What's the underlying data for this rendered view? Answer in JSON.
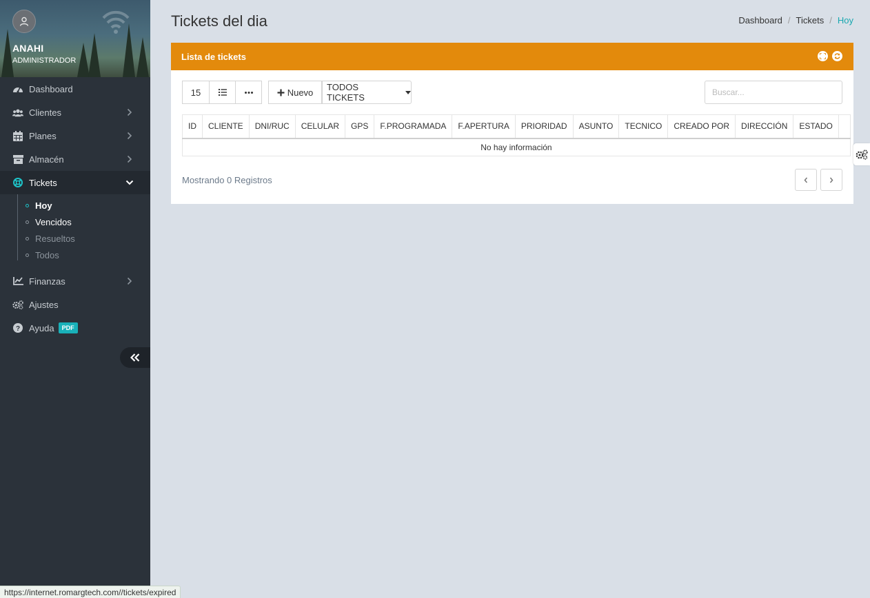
{
  "profile": {
    "name": "ANAHI",
    "role": "ADMINISTRADOR"
  },
  "sidebar": {
    "items": [
      {
        "label": "Dashboard",
        "icon": "tachometer-icon"
      },
      {
        "label": "Clientes",
        "icon": "users-icon"
      },
      {
        "label": "Planes",
        "icon": "calendar-icon"
      },
      {
        "label": "Almacén",
        "icon": "archive-icon"
      },
      {
        "label": "Tickets",
        "icon": "lifebuoy-icon"
      },
      {
        "label": "Finanzas",
        "icon": "line-chart-icon"
      },
      {
        "label": "Ajustes",
        "icon": "cogs-icon"
      },
      {
        "label": "Ayuda",
        "icon": "question-circle-icon",
        "badge": "PDF"
      }
    ],
    "tickets_sub": [
      "Hoy",
      "Vencidos",
      "Resueltos",
      "Todos"
    ]
  },
  "page": {
    "title": "Tickets del dia"
  },
  "breadcrumb": [
    "Dashboard",
    "Tickets",
    "Hoy"
  ],
  "card": {
    "title": "Lista de tickets"
  },
  "toolbar": {
    "page_size": "15",
    "new_label": "Nuevo",
    "filter_label": "TODOS TICKETS"
  },
  "search": {
    "placeholder": "Buscar..."
  },
  "table": {
    "columns": [
      "ID",
      "CLIENTE",
      "DNI/RUC",
      "CELULAR",
      "GPS",
      "F.PROGRAMADA",
      "F.APERTURA",
      "PRIORIDAD",
      "ASUNTO",
      "TECNICO",
      "CREADO POR",
      "DIRECCIÓN",
      "ESTADO"
    ],
    "empty_text": "No hay información"
  },
  "footer": {
    "records_text": "Mostrando 0 Registros"
  },
  "statusbar": {
    "url": "https://internet.romargtech.com//tickets/expired"
  },
  "colors": {
    "accent": "#e38a0c",
    "sidebar": "#2b323a",
    "teal": "#19a8b0"
  }
}
